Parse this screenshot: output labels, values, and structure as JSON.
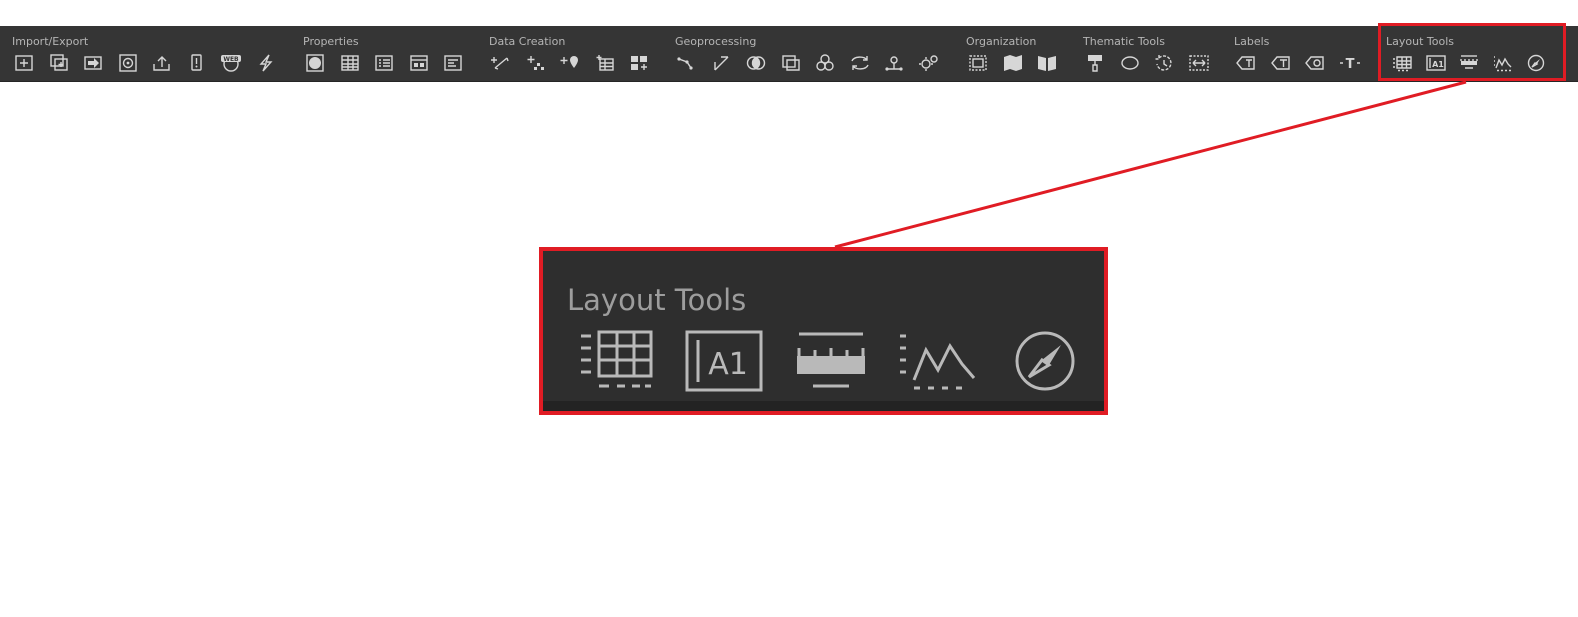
{
  "ribbon": {
    "groups": [
      {
        "label": "Import/Export",
        "icons": [
          "add-data-icon",
          "add-layers-icon",
          "import-icon",
          "gps-target-icon",
          "upload-icon",
          "mobile-export-icon",
          "web-map-icon",
          "lightning-icon"
        ]
      },
      {
        "label": "Properties",
        "icons": [
          "globe-properties-icon",
          "attribute-table-icon",
          "list-properties-icon",
          "metadata-icon",
          "details-icon"
        ]
      },
      {
        "label": "Data Creation",
        "icons": [
          "create-features-icon",
          "add-points-icon",
          "add-location-icon",
          "new-table-icon",
          "add-field-icon"
        ]
      },
      {
        "label": "Geoprocessing",
        "icons": [
          "polyline-icon",
          "line-tool-icon",
          "intersect-icon",
          "clip-icon",
          "merge-circles-icon",
          "convert-icon",
          "network-icon",
          "settings-gears-icon"
        ]
      },
      {
        "label": "Organization",
        "icons": [
          "frame-icon",
          "map-book-icon",
          "book-icon"
        ]
      },
      {
        "label": "Thematic Tools",
        "icons": [
          "symbology-brush-icon",
          "ellipse-icon",
          "rotate-icon",
          "extent-icon"
        ]
      },
      {
        "label": "Labels",
        "icons": [
          "add-label-icon",
          "text-label-icon",
          "label-settings-icon",
          "text-tool-icon"
        ]
      },
      {
        "label": "Layout Tools",
        "icons": [
          "grid-table-icon",
          "a1-cell-icon",
          "scale-bar-icon",
          "chart-icon",
          "compass-icon"
        ]
      }
    ],
    "web_badge": "WEB",
    "a1_text": "A1",
    "t_glyph": "T"
  },
  "zoom": {
    "label": "Layout Tools",
    "icons": [
      "grid-table-icon",
      "a1-cell-icon",
      "scale-bar-icon",
      "chart-icon",
      "compass-icon"
    ],
    "a1_text": "A1"
  },
  "colors": {
    "ribbon_bg": "#353535",
    "highlight": "#e01c24",
    "icon": "#d6d6d6",
    "label": "#b5b5b5"
  }
}
